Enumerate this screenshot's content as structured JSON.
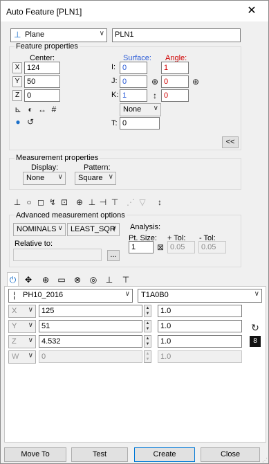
{
  "window": {
    "title": "Auto Feature [PLN1]",
    "close_glyph": "✕"
  },
  "feature": {
    "type_value": "Plane",
    "type_icon": "plane-icon",
    "id_value": "PLN1"
  },
  "feature_props": {
    "label": "Feature properties",
    "center_label": "Center:",
    "surface_label": "Surface:",
    "angle_label": "Angle:",
    "x_axis": "X",
    "y_axis": "Y",
    "z_axis": "Z",
    "x": "124",
    "y": "50",
    "z": "0",
    "i_label": "I:",
    "j_label": "J:",
    "k_label": "K:",
    "i_surface": "0",
    "j_surface": "0",
    "k_surface": "1",
    "i_angle": "1",
    "j_angle": "0",
    "k_angle": "0",
    "none_combo": "None",
    "t_label": "T:",
    "t_value": "0",
    "collapse_label": "<<"
  },
  "measurement_props": {
    "label": "Measurement properties",
    "display_label": "Display:",
    "display_value": "None",
    "pattern_label": "Pattern:",
    "pattern_value": "Square"
  },
  "advanced": {
    "label": "Advanced measurement options",
    "nominals_value": "NOMINALS",
    "fit_value": "LEAST_SQR",
    "relative_label": "Relative to:",
    "relative_value": "",
    "browse_label": "...",
    "analysis_label": "Analysis:",
    "pt_size_label": "Pt. Size:",
    "pt_size_value": "1",
    "plus_tol_label": "+ Tol:",
    "plus_tol_value": "0.05",
    "minus_tol_label": "- Tol:",
    "minus_tol_value": "0.05"
  },
  "probe": {
    "probe_value": "PH10_2016",
    "tip_value": "T1A0B0",
    "rows": [
      {
        "axis": "X",
        "value": "125",
        "scale": "1.0",
        "disabled": false
      },
      {
        "axis": "Y",
        "value": "51",
        "scale": "1.0",
        "disabled": false
      },
      {
        "axis": "Z",
        "value": "4.532",
        "scale": "1.0",
        "disabled": false
      },
      {
        "axis": "W",
        "value": "0",
        "scale": "1.0",
        "disabled": true
      }
    ]
  },
  "buttons": {
    "move_to": "Move To",
    "test": "Test",
    "create": "Create",
    "close": "Close"
  }
}
